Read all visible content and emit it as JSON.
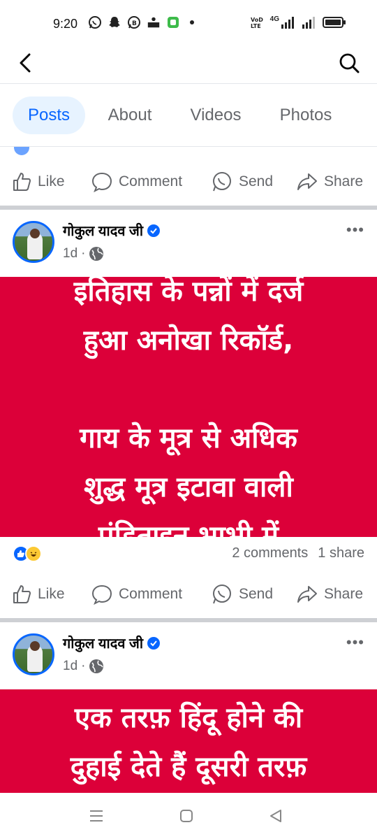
{
  "status_bar": {
    "time": "9:20",
    "network_label": "4G",
    "left_icons": [
      "whatsapp-icon",
      "snapchat-icon",
      "whatsapp-business-icon",
      "news-app-icon",
      "app-icon"
    ],
    "right_icons": [
      "volte-icon",
      "signal-icon",
      "signal-icon-2",
      "battery-icon"
    ]
  },
  "top_bar": {
    "back_icon": "chevron-left-icon",
    "search_icon": "search-icon"
  },
  "tabs": [
    {
      "label": "Posts",
      "active": true
    },
    {
      "label": "About",
      "active": false
    },
    {
      "label": "Videos",
      "active": false
    },
    {
      "label": "Photos",
      "active": false
    }
  ],
  "actions": {
    "like": "Like",
    "comment": "Comment",
    "send": "Send",
    "share": "Share"
  },
  "posts": [
    {
      "author": "गोकुल यादव जी",
      "time": "1d",
      "privacy_icon": "globe-icon",
      "image_text": [
        "इतिहास के पन्नों में दर्ज",
        "हुआ अनोखा रिकॉर्ड,",
        "",
        "गाय के मूत्र से अधिक",
        "शुद्ध मूत्र इटावा वाली",
        "पंडिताइन भाभी में"
      ],
      "reactions": [
        "like-reaction-icon",
        "haha-reaction-icon"
      ],
      "comments": "2 comments",
      "shares": "1 share"
    },
    {
      "author": "गोकुल यादव जी",
      "time": "1d",
      "privacy_icon": "globe-icon",
      "image_text": [
        "एक तरफ़ हिंदू होने की",
        "दुहाई देते हैं दूसरी तरफ़"
      ]
    }
  ],
  "colors": {
    "accent": "#0866ff",
    "post_background": "#dc0039",
    "secondary_text": "#65676b",
    "tab_active_bg": "#e7f3ff"
  },
  "nav_bar": {
    "icons": [
      "menu-icon",
      "home-icon",
      "back-triangle-icon"
    ]
  }
}
